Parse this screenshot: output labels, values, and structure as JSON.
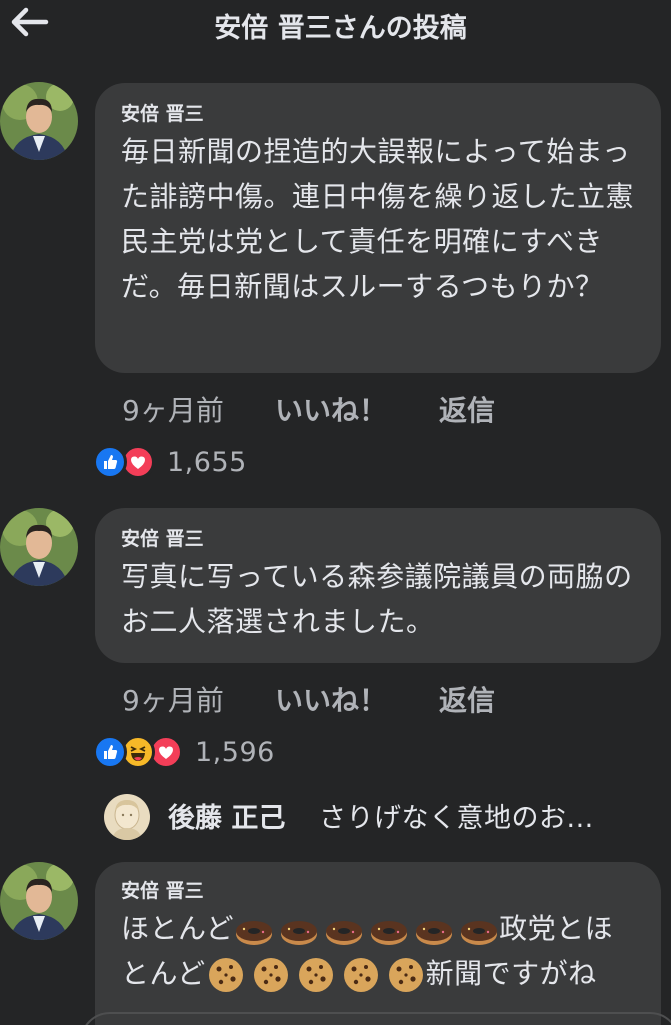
{
  "header": {
    "title": "安倍 晋三さんの投稿"
  },
  "comments": [
    {
      "author": "安倍 晋三",
      "text": "毎日新聞の捏造的大誤報によって始まった誹謗中傷。連日中傷を繰り返した立憲民主党は党として責任を明確にすべきだ。毎日新聞はスルーするつもりか？",
      "time": "9ヶ月前",
      "like_label": "いいね！",
      "reply_label": "返信",
      "reactions": [
        "like",
        "love"
      ],
      "reaction_count": "1,655"
    },
    {
      "author": "安倍 晋三",
      "text": "写真に写っている森参議院議員の両脇のお二人落選されました。",
      "time": "9ヶ月前",
      "like_label": "いいね！",
      "reply_label": "返信",
      "reactions": [
        "like",
        "haha",
        "love"
      ],
      "reaction_count": "1,596",
      "reply_preview": {
        "author": "後藤 正己",
        "snippet": "さりげなく意地のお..."
      }
    },
    {
      "author": "安倍 晋三",
      "text_part1": "ほとんど",
      "text_part2": "政党とほ",
      "text_part3": "とんど",
      "text_part4": "新聞ですがね",
      "emoji_1": "donut",
      "emoji_2": "cookie"
    }
  ],
  "colors": {
    "background": "#242526",
    "bubble": "#3a3b3c",
    "like_blue": "#1877f2",
    "love_red": "#f33e58",
    "haha_yellow": "#f7b928"
  }
}
